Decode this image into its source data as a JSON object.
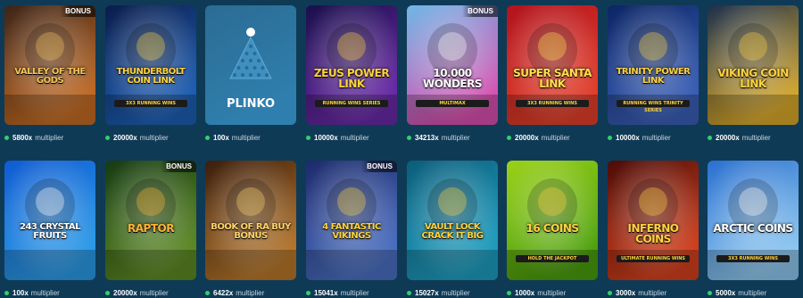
{
  "multiplier_label": "multiplier",
  "badge_text": "BONUS",
  "row1": [
    {
      "title": "VALLEY OF THE GODS",
      "sub": "",
      "multiplier": "5800x",
      "bonus": true,
      "bg1": "#3b2418",
      "bg2": "#c46b24",
      "color": "#f4c45a"
    },
    {
      "title": "THUNDERBOLT COIN LINK",
      "sub": "3X3 RUNNING WINS",
      "multiplier": "20000x",
      "bonus": false,
      "bg1": "#0b1c4a",
      "bg2": "#1d5fb5",
      "color": "#ffd23d"
    },
    {
      "title": "PLINKO",
      "sub": "",
      "multiplier": "100x",
      "bonus": false,
      "bg1": "#2b6c94",
      "bg2": "#2f7fae",
      "color": "#ffffff"
    },
    {
      "title": "ZEUS POWER LINK",
      "sub": "RUNNING WINS SERIES",
      "multiplier": "10000x",
      "bonus": false,
      "bg1": "#1a0f4a",
      "bg2": "#6a2aa8",
      "color": "#ffd23d"
    },
    {
      "title": "10.000 Wonders",
      "sub": "MULTIMAX",
      "multiplier": "34213x",
      "bonus": true,
      "bg1": "#6fb7e6",
      "bg2": "#d94fb0",
      "color": "#ffffff"
    },
    {
      "title": "SUPER SANTA LINK",
      "sub": "3X3 RUNNING WINS",
      "multiplier": "20000x",
      "bonus": false,
      "bg1": "#b1121d",
      "bg2": "#e33f2a",
      "color": "#ffe14a"
    },
    {
      "title": "TRINITY POWER LINK",
      "sub": "RUNNING WINS TRINITY SERIES",
      "multiplier": "10000x",
      "bonus": false,
      "bg1": "#0b2563",
      "bg2": "#3a5fb8",
      "color": "#ffd23d"
    },
    {
      "title": "VIKING COIN LINK",
      "sub": "",
      "multiplier": "20000x",
      "bonus": false,
      "bg1": "#1b2f4d",
      "bg2": "#d9a92a",
      "color": "#ffd23d"
    }
  ],
  "row2": [
    {
      "title": "243 CRYSTAL FRUITS",
      "sub": "",
      "multiplier": "100x",
      "bonus": false,
      "bg1": "#0f5bd1",
      "bg2": "#2b9be8",
      "color": "#ffffff"
    },
    {
      "title": "RAPTOR",
      "sub": "",
      "multiplier": "20000x",
      "bonus": true,
      "bg1": "#163a14",
      "bg2": "#5d8a22",
      "color": "#ffb330"
    },
    {
      "title": "BOOK OF RA BUY BONUS",
      "sub": "",
      "multiplier": "6422x",
      "bonus": false,
      "bg1": "#3a1d0c",
      "bg2": "#b7772b",
      "color": "#ffd46a"
    },
    {
      "title": "4 FANTASTIC VIKINGS",
      "sub": "",
      "multiplier": "15041x",
      "bonus": true,
      "bg1": "#1d2a6a",
      "bg2": "#4a6fc2",
      "color": "#ffd23d"
    },
    {
      "title": "VAULT LOCK CRACK IT BIG",
      "sub": "",
      "multiplier": "15027x",
      "bonus": false,
      "bg1": "#0a5d7a",
      "bg2": "#1e9ec0",
      "color": "#ffd23d"
    },
    {
      "title": "16 COINS",
      "sub": "HOLD THE JACKPOT",
      "multiplier": "1000x",
      "bonus": false,
      "bg1": "#9bd118",
      "bg2": "#4a9e0c",
      "color": "#ffd23d"
    },
    {
      "title": "INFERNO COINS",
      "sub": "ULTIMATE RUNNING WINS",
      "multiplier": "3000x",
      "bonus": false,
      "bg1": "#4a0c08",
      "bg2": "#d5401c",
      "color": "#ffd23d"
    },
    {
      "title": "ARCTIC COINS",
      "sub": "3X3 RUNNING WINS",
      "multiplier": "5000x",
      "bonus": false,
      "bg1": "#2a6fcf",
      "bg2": "#8ec9f1",
      "color": "#ffffff"
    }
  ]
}
